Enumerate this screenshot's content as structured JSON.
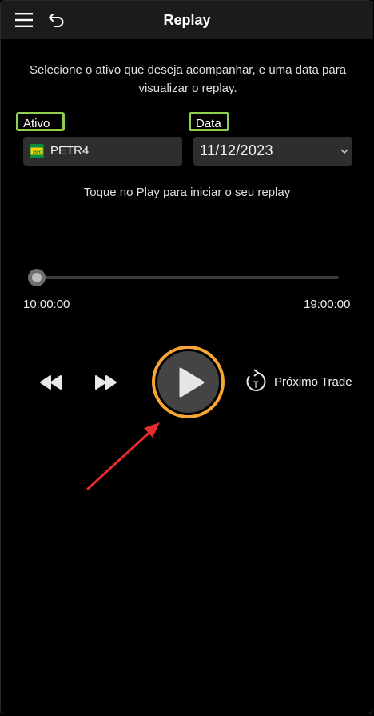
{
  "header": {
    "title": "Replay",
    "menu_icon": "hamburger-menu-icon",
    "back_icon": "undo-back-icon"
  },
  "intro": {
    "text": "Selecione o ativo que deseja acompanhar, e uma data para visualizar o replay."
  },
  "form": {
    "asset_label": "Ativo",
    "asset_value": "PETR4",
    "asset_logo_text": "BR",
    "date_label": "Data",
    "date_value": "11/12/2023"
  },
  "hint": "Toque no Play para iniciar o seu replay",
  "timeline": {
    "start_time": "10:00:00",
    "end_time": "19:00:00",
    "progress": 0
  },
  "controls": {
    "next_trade_label": "Próximo Trade",
    "next_trade_icon_letter": "T"
  },
  "colors": {
    "background": "#000000",
    "appbar": "#1b1b1b",
    "highlight_green": "#8fd14f",
    "highlight_orange": "#f7a535",
    "arrow_red": "#e52b2b",
    "field_bg": "#2e2e2e"
  }
}
